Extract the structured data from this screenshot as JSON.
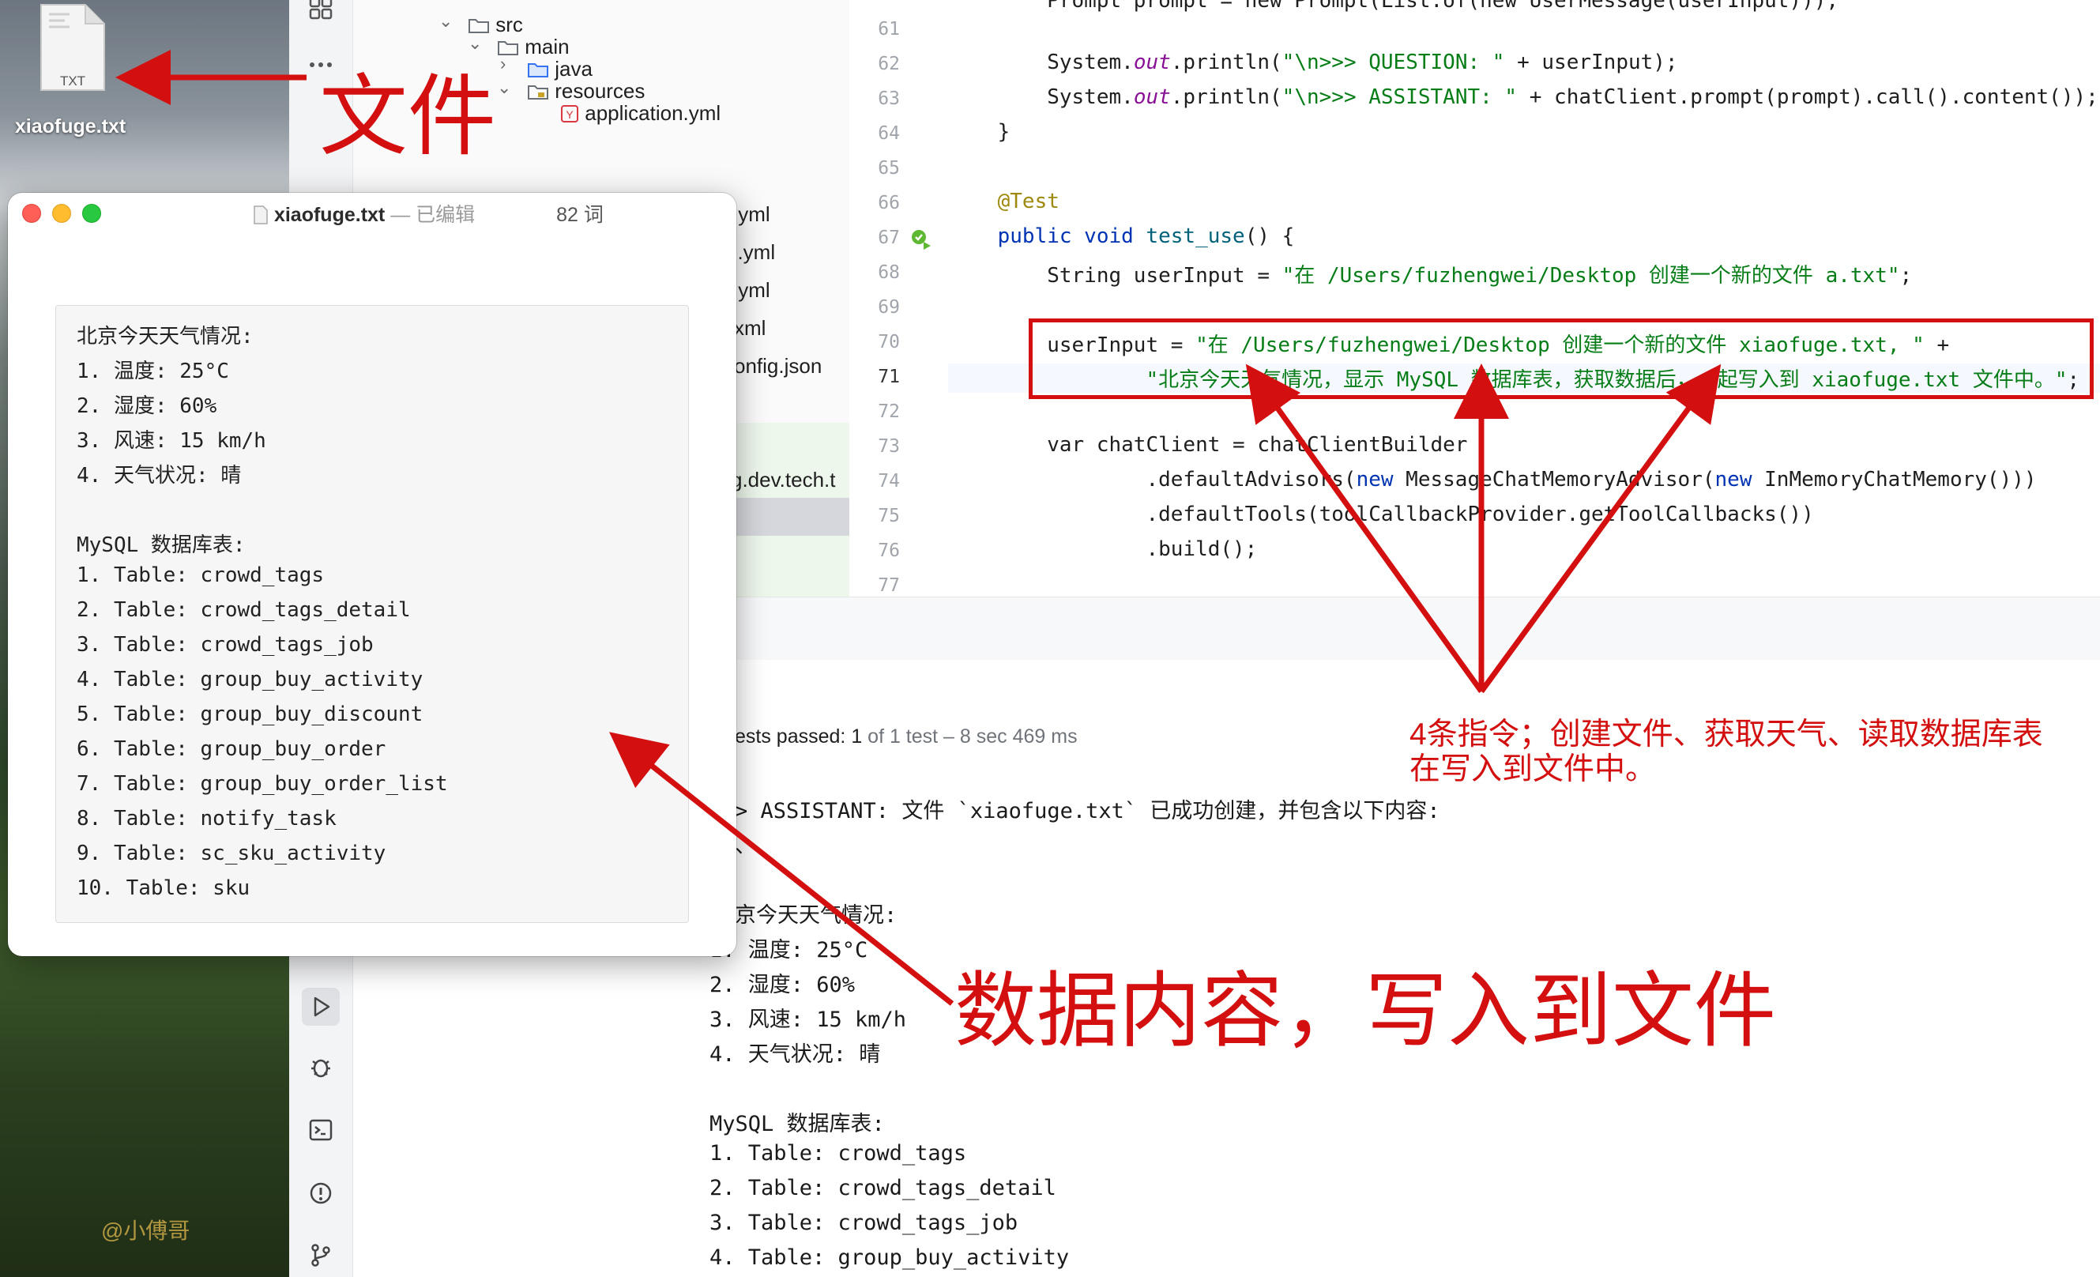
{
  "desktop": {
    "file_icon_label": "TXT",
    "file_name": "xiaofuge.txt",
    "watermark": "@小傅哥"
  },
  "tree": [
    {
      "label": "src"
    },
    {
      "label": "main"
    },
    {
      "label": "java"
    },
    {
      "label": "resources"
    },
    {
      "label": "application.yml"
    },
    {
      "label": ".yml"
    },
    {
      "label": "d.yml"
    },
    {
      "label": ".yml"
    },
    {
      "label": "xml"
    },
    {
      "label": "onfig.json"
    },
    {
      "label": "g.dev.tech.t"
    }
  ],
  "editor": {
    "line_numbers": [
      "61",
      "62",
      "63",
      "64",
      "65",
      "66",
      "67",
      "68",
      "69",
      "70",
      "71",
      "72",
      "73",
      "74",
      "75",
      "76",
      "77"
    ],
    "lines": {
      "l61": "        Prompt prompt = new Prompt(List.of(new UserMessage(userInput)));",
      "l62a": "        System.",
      "l62b": "out",
      "l62c": ".println(",
      "l62d": "\"\\n>>> QUESTION: \"",
      "l62e": " + userInput);",
      "l63a": "        System.",
      "l63b": "out",
      "l63c": ".println(",
      "l63d": "\"\\n>>> ASSISTANT: \"",
      "l63e": " + chatClient.prompt(prompt).call().content());",
      "l64": "    }",
      "l66": "    @Test",
      "l67a": "    public void ",
      "l67b": "test_use",
      "l67c": "() {",
      "l68a": "        String userInput = ",
      "l68b": "\"在 /Users/fuzhengwei/Desktop 创建一个新的文件 a.txt\"",
      "l68c": ";",
      "l70a": "        userInput = ",
      "l70b": "\"在 /Users/fuzhengwei/Desktop 创建一个新的文件 xiaofuge.txt, \"",
      "l70c": " +",
      "l71a": "                ",
      "l71b": "\"北京今天天气情况，显示 MySQL 数据库表，获取数据后，一起写入到 xiaofuge.txt 文件中。\"",
      "l71c": ";",
      "l73a": "        var chatClient = chatClientBuilder",
      "l74a": "                .defaultAdvisors(",
      "l74b": "new",
      "l74c": " MessageChatMemoryAdvisor(",
      "l74d": "new",
      "l74e": " InMemoryChatMemory()))",
      "l75": "                .defaultTools(toolCallbackProvider.getToolCallbacks())",
      "l76": "                .build();"
    }
  },
  "run": {
    "tests_passed_a": "ests passed: ",
    "tests_passed_b": "1",
    "tests_passed_c": " of 1 test – 8 sec 469 ms"
  },
  "console": [
    "> ASSISTANT: 文件 `xiaofuge.txt` 已成功创建，并包含以下内容:",
    "、",
    "京今天天气情况:",
    "1. 温度: 25°C",
    "2. 湿度: 60%",
    "3. 风速: 15 km/h",
    "4. 天气状况: 晴",
    "",
    "MySQL 数据库表:",
    "1. Table: crowd_tags",
    "2. Table: crowd_tags_detail",
    "3. Table: crowd_tags_job",
    "4. Table: group_buy_activity"
  ],
  "textedit": {
    "title": "xiaofuge.txt",
    "separator": "—",
    "status": "已编辑",
    "word_count": "82 词",
    "lines": [
      "北京今天天气情况:",
      "1. 温度: 25°C",
      "2. 湿度: 60%",
      "3. 风速: 15 km/h",
      "4. 天气状况: 晴",
      "",
      "MySQL 数据库表:",
      "1. Table: crowd_tags",
      "2. Table: crowd_tags_detail",
      "3. Table: crowd_tags_job",
      "4. Table: group_buy_activity",
      "5. Table: group_buy_discount",
      "6. Table: group_buy_order",
      "7. Table: group_buy_order_list",
      "8. Table: notify_task",
      "9. Table: sc_sku_activity",
      "10. Table: sku"
    ]
  },
  "annotations": {
    "file_label": "文件",
    "instructions_line1": "4条指令；创建文件、获取天气、读取数据库表",
    "instructions_line2": "在写入到文件中。",
    "data_label": "数据内容，写入到文件",
    "color": "#d40f0f"
  }
}
